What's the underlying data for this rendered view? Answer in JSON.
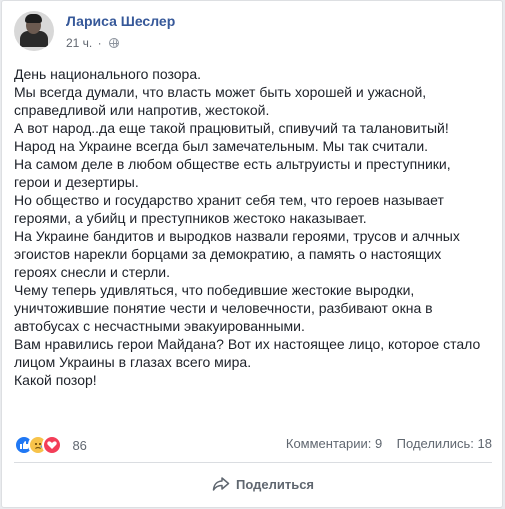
{
  "post": {
    "author": "Лариса Шеслер",
    "time": "21 ч.",
    "privacy_icon": "globe-icon",
    "lines": [
      "День национального позора.",
      "Мы всегда думали, что власть может быть хорошей и ужасной,",
      "справедливой или напротив, жестокой.",
      "А вот народ..да еще такой працювитый, спивучий та талановитый!",
      "Народ на Украине всегда был замечательным. Мы так считали.",
      "На самом деле в любом обществе есть альтруисты и преступники,",
      "герои и дезертиры.",
      "Но общество и государство хранит себя тем, что героев называет",
      "героями, а убийц и преступников жестоко наказывает.",
      "На Украине бандитов и выродков назвали героями, трусов и алчных",
      "эгоистов нарекли борцами за демократию, а память о настоящих",
      "героях снесли и стерли.",
      "Чему теперь удивляться, что победившие жестокие выродки,",
      "уничтожившие понятие чести и человечности, разбивают окна в",
      "автобусах с несчастными эвакуированными.",
      "Вам нравились герои Майдана? Вот их настоящее лицо, которое стало",
      "лицом Украины в глазах всего мира.",
      "Какой позор!"
    ]
  },
  "reactions": {
    "icons": [
      "like-icon",
      "sad-icon",
      "love-icon"
    ],
    "count": "86"
  },
  "counts": {
    "comments": "Комментарии: 9",
    "shares": "Поделились: 18"
  },
  "actions": {
    "share_label": "Поделиться"
  },
  "colors": {
    "author_link": "#365899",
    "like": "#2078f4",
    "love": "#f33e58",
    "sad": "#f7c34a"
  }
}
